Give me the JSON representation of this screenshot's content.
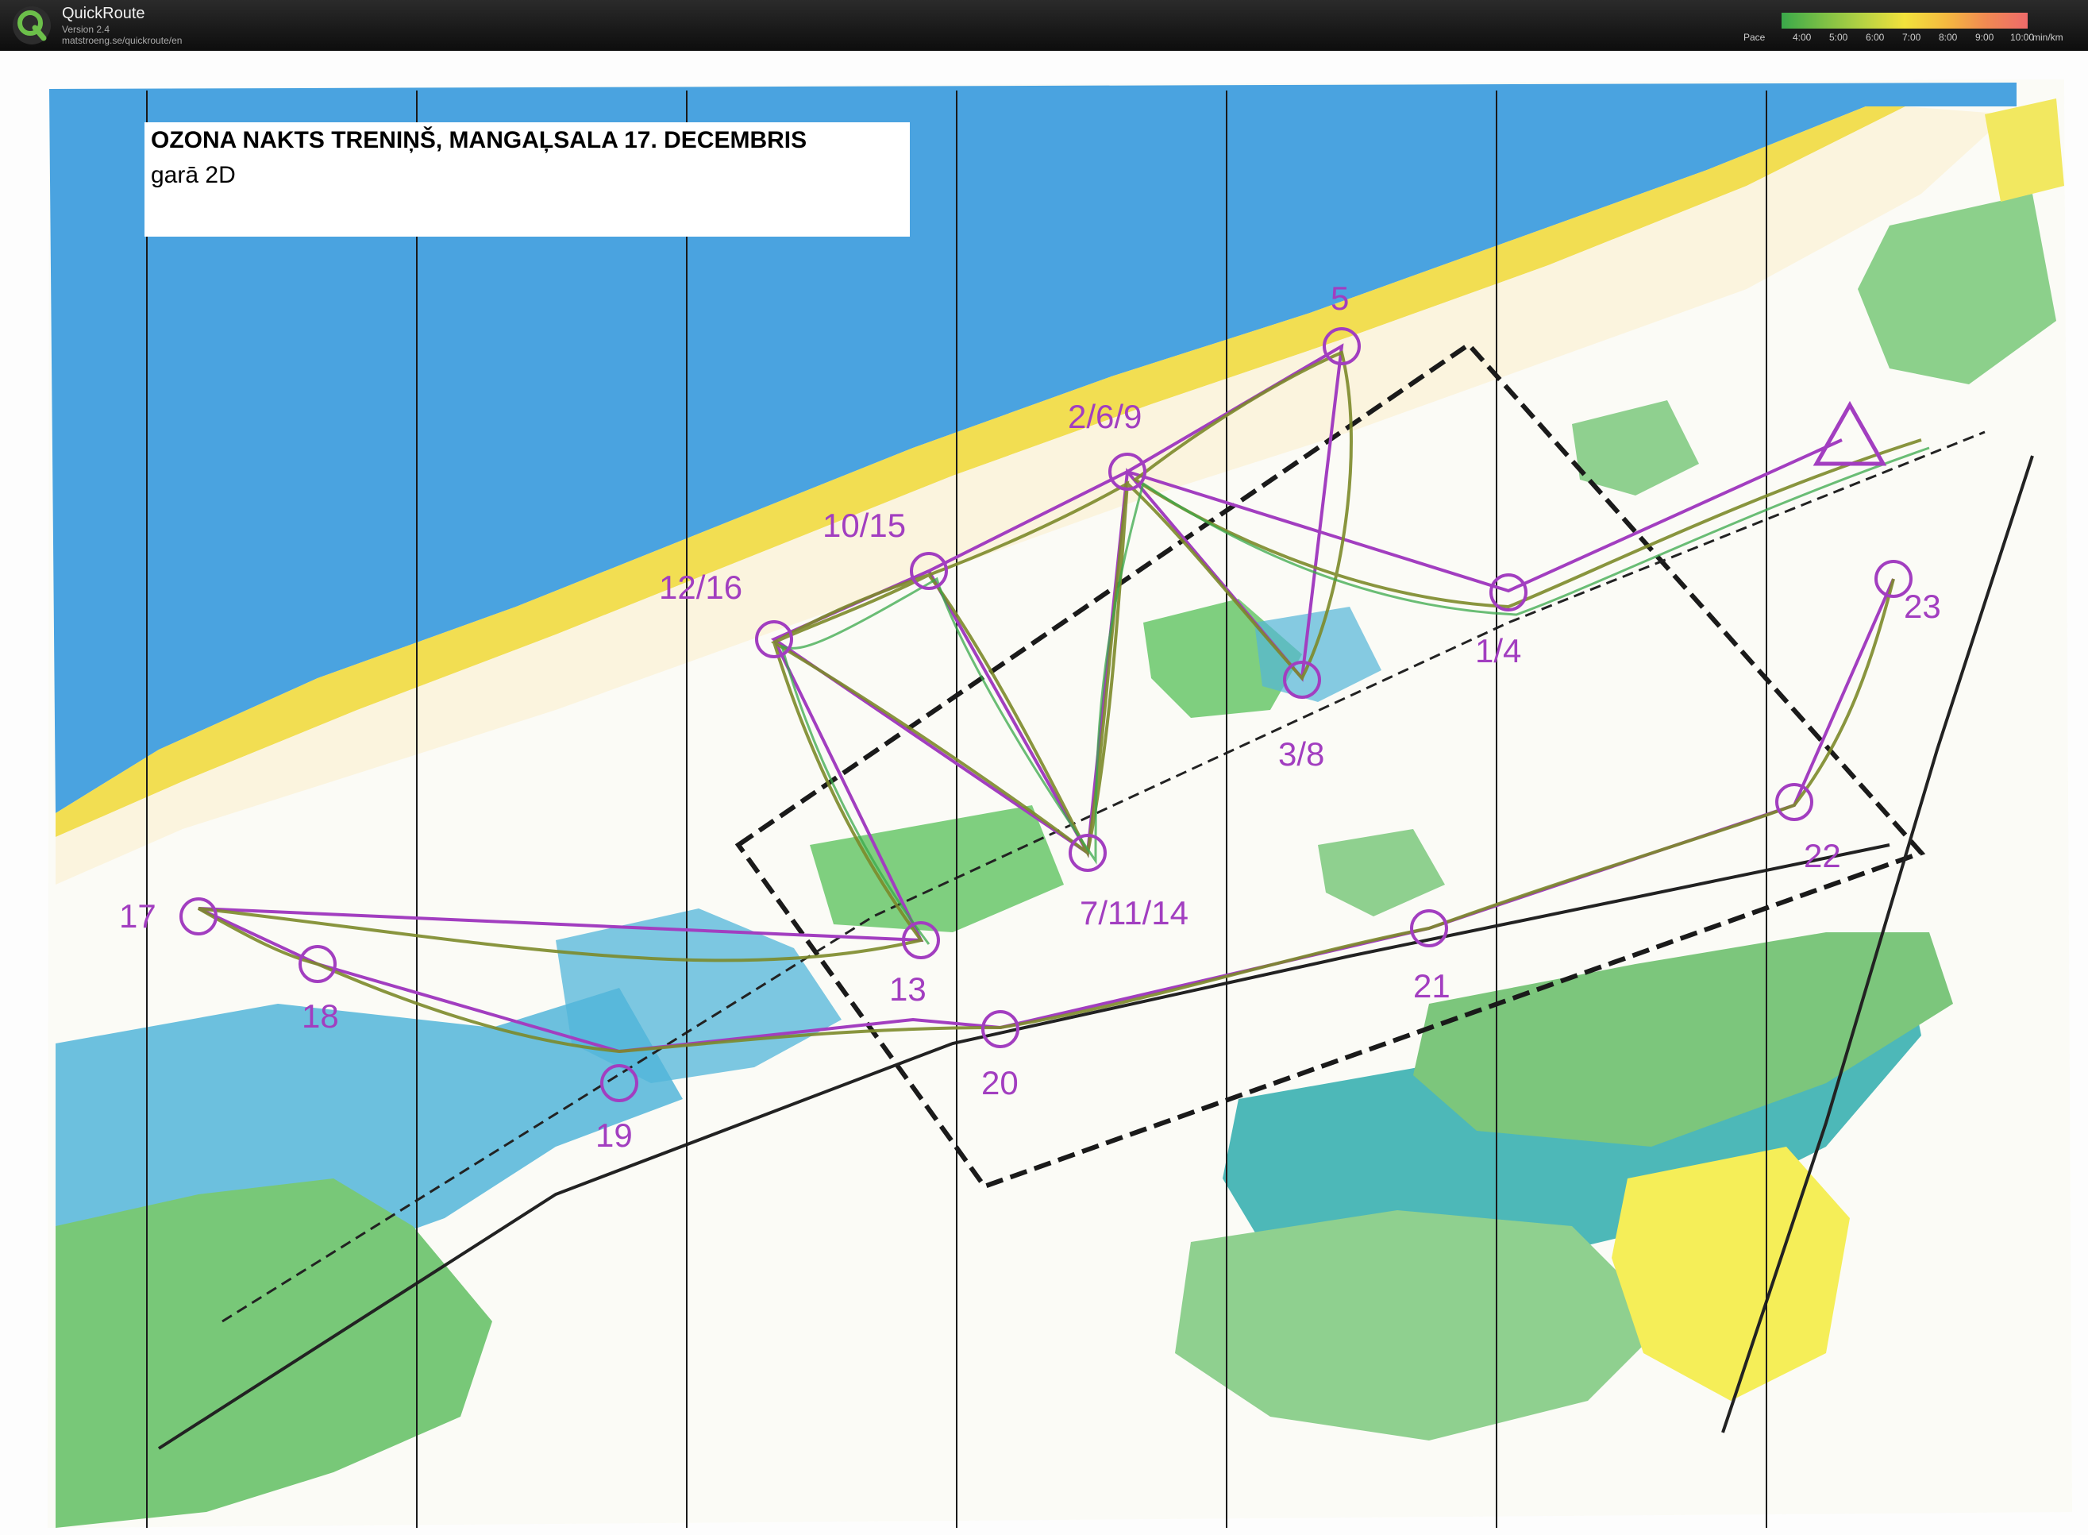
{
  "app": {
    "name": "QuickRoute",
    "version": "Version 2.4",
    "url": "matstroeng.se/quickroute/en"
  },
  "pace_legend": {
    "label": "Pace",
    "ticks": [
      "4:00",
      "5:00",
      "6:00",
      "7:00",
      "8:00",
      "9:00",
      "10:00"
    ],
    "unit": "min/km",
    "colors": [
      "#3aa84a",
      "#7cc045",
      "#b6d243",
      "#f2e23c",
      "#f4b940",
      "#f18a52",
      "#ee6a6a"
    ]
  },
  "map": {
    "title": "OZONA NAKTS TRENIŅŠ, MANGAĻSALA 17. DECEMBRIS",
    "subtitle": "garā 2D",
    "colors": {
      "sea": "#4aa3e0",
      "beach": "#f2de52",
      "forest_green": "#78c878",
      "open_yellow": "#f5ee58",
      "marsh_blue": "#52b5d9",
      "contours": "#b0714a",
      "course_purple": "#a23ec0",
      "route_olive": "#7c8a2a"
    },
    "controls": [
      {
        "id": "start",
        "label": ""
      },
      {
        "id": "c1-4",
        "label": "1/4"
      },
      {
        "id": "c2-6-9",
        "label": "2/6/9"
      },
      {
        "id": "c3-8",
        "label": "3/8"
      },
      {
        "id": "c5",
        "label": "5"
      },
      {
        "id": "c7-11-14",
        "label": "7/11/14"
      },
      {
        "id": "c10-15",
        "label": "10/15"
      },
      {
        "id": "c12-16",
        "label": "12/16"
      },
      {
        "id": "c13",
        "label": "13"
      },
      {
        "id": "c17",
        "label": "17"
      },
      {
        "id": "c18",
        "label": "18"
      },
      {
        "id": "c19",
        "label": "19"
      },
      {
        "id": "c20",
        "label": "20"
      },
      {
        "id": "c21",
        "label": "21"
      },
      {
        "id": "c22",
        "label": "22"
      },
      {
        "id": "c23",
        "label": "23"
      }
    ]
  }
}
